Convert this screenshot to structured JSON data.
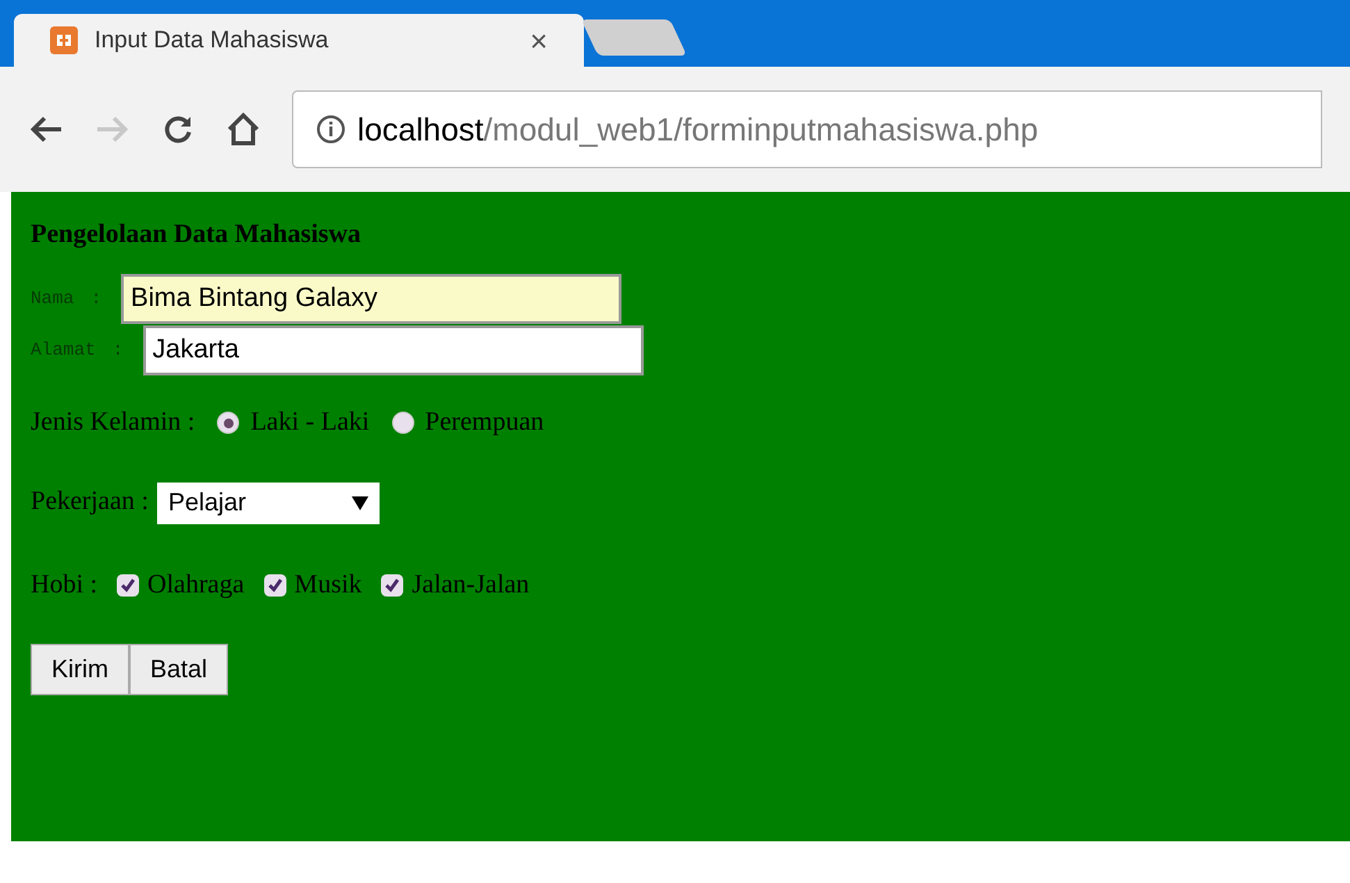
{
  "tab": {
    "title": "Input Data Mahasiswa",
    "close": "×"
  },
  "address": {
    "host": "localhost",
    "path": "/modul_web1/forminputmahasiswa.php"
  },
  "heading": "Pengelolaan Data Mahasiswa",
  "fields": [
    {
      "label": "Nama",
      "colon": ":",
      "value": "Bima Bintang Galaxy",
      "autofilled": true
    },
    {
      "label": "Alamat",
      "colon": ":",
      "value": "Jakarta",
      "autofilled": false
    }
  ],
  "gender": {
    "label": "Jenis Kelamin :",
    "options": [
      {
        "label": "Laki - Laki",
        "selected": true
      },
      {
        "label": "Perempuan",
        "selected": false
      }
    ]
  },
  "job": {
    "label": "Pekerjaan :",
    "value": "Pelajar"
  },
  "hobbies": {
    "label": "Hobi :",
    "options": [
      {
        "label": "Olahraga",
        "checked": true
      },
      {
        "label": "Musik",
        "checked": true
      },
      {
        "label": "Jalan-Jalan",
        "checked": true
      }
    ]
  },
  "buttons": [
    "Kirim",
    "Batal"
  ]
}
